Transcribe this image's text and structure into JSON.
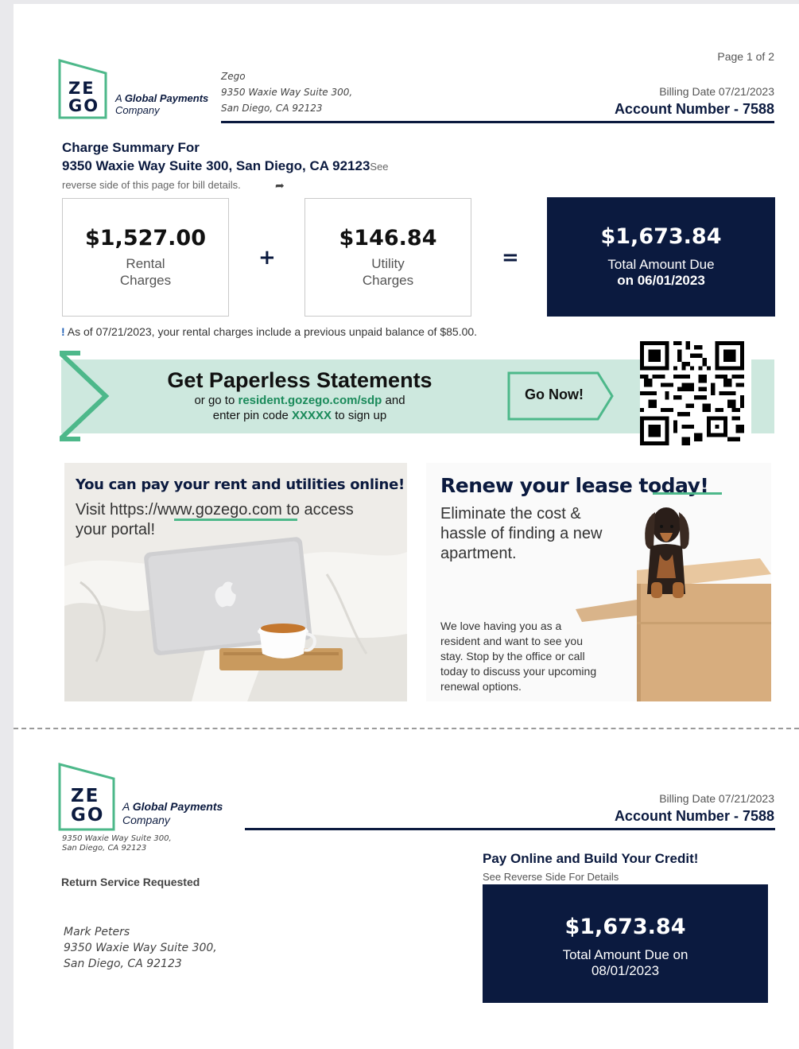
{
  "page": {
    "page_indicator": "Page 1 of 2"
  },
  "header": {
    "logo_line1": "ZE",
    "logo_line2": "GO",
    "gp_line1_prefix": "A ",
    "gp_line1_bold": "Global Payments",
    "gp_line2": "Company",
    "company_name": "Zego",
    "company_addr1": "9350 Waxie Way Suite 300,",
    "company_addr2": "San Diego, CA 92123",
    "billing_date": "Billing Date 07/21/2023",
    "account_number": "Account Number - 7588"
  },
  "summary": {
    "title": "Charge Summary For",
    "address": "9350 Waxie Way Suite 300, San Diego, CA 92123",
    "see_word": "See",
    "reverse_note": "reverse side of this page for bill details.",
    "rental_amount": "$1,527.00",
    "rental_l1": "Rental",
    "rental_l2": "Charges",
    "plus": "+",
    "utility_amount": "$146.84",
    "utility_l1": "Utility",
    "utility_l2": "Charges",
    "equals": "=",
    "total_amount": "$1,673.84",
    "total_l1": "Total Amount Due",
    "total_l2": "on 06/01/2023",
    "notice_mark": "!",
    "notice": "As of 07/21/2023, your rental charges include a previous unpaid balance of $85.00."
  },
  "paperless": {
    "title": "Get Paperless Statements",
    "line1_prefix": "or go to ",
    "line1_link": "resident.gozego.com/sdp",
    "line1_suffix": " and",
    "line2_prefix": "enter pin code ",
    "line2_pin": "XXXXX",
    "line2_suffix": " to sign up",
    "button": "Go Now!"
  },
  "promo_pay": {
    "title": "You can pay your rent and utilities online!",
    "line1": "Visit https://www.gozego.com to access",
    "line2": "your portal!"
  },
  "promo_lease": {
    "title": "Renew your lease today!",
    "line1": "Eliminate the cost &",
    "line2": "hassle of finding a new",
    "line3": "apartment.",
    "body1": "We love having you as a",
    "body2": "resident and want to see you",
    "body3": "stay. Stop by the office or call",
    "body4": "today to discuss your upcoming",
    "body5": "renewal options."
  },
  "stub": {
    "logo_line1": "ZE",
    "logo_line2": "GO",
    "gp_line1_prefix": "A ",
    "gp_line1_bold": "Global Payments",
    "gp_line2": "Company",
    "addr1": "9350 Waxie Way Suite 300,",
    "addr2": "San Diego, CA 92123",
    "billing_date": "Billing Date 07/21/2023",
    "account_number": "Account Number - 7588",
    "return_service": "Return Service Requested",
    "recipient_name": "Mark Peters",
    "recipient_addr1": "9350 Waxie Way Suite 300,",
    "recipient_addr2": "San Diego, CA 92123",
    "pay_title": "Pay Online and Build Your Credit!",
    "pay_sub": "See Reverse Side For Details",
    "total_amount": "$1,673.84",
    "total_l1": "Total Amount Due on",
    "total_l2": "08/01/2023"
  },
  "colors": {
    "navy": "#0b1a3f",
    "green": "#1a8a5a",
    "mint": "#cde8de",
    "logo_green": "#4db88a"
  }
}
